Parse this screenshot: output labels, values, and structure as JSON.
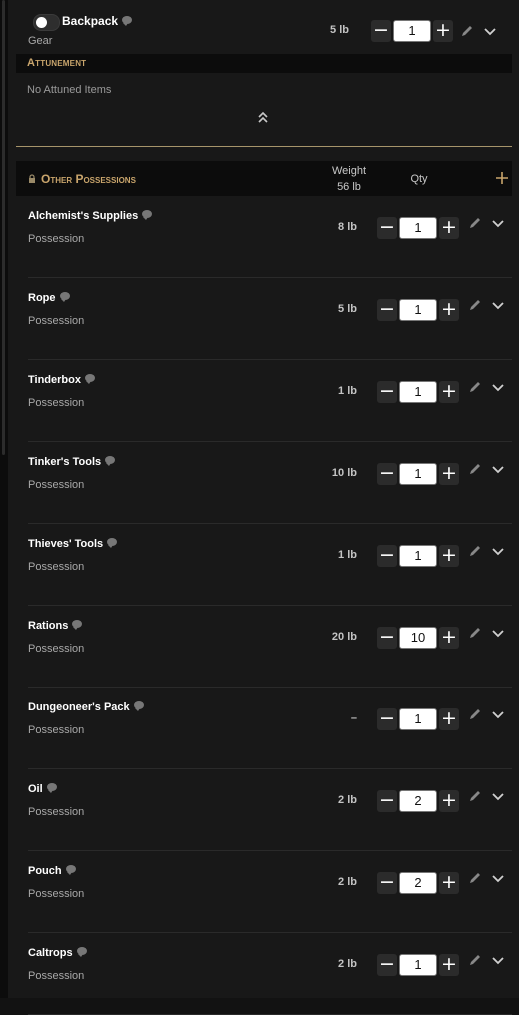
{
  "backpack": {
    "name": "Backpack",
    "type": "Gear",
    "weight": "5 lb",
    "qty": "1",
    "toggle_on": false
  },
  "attunement": {
    "title": "Attunement",
    "empty_text": "No Attuned Items"
  },
  "other_possessions": {
    "title": "Other Possessions",
    "weight_header": "Weight",
    "total_weight": "56 lb",
    "qty_header": "Qty",
    "items": [
      {
        "name": "Alchemist's Supplies",
        "type": "Possession",
        "weight": "8 lb",
        "qty": "1"
      },
      {
        "name": "Rope",
        "type": "Possession",
        "weight": "5 lb",
        "qty": "1"
      },
      {
        "name": "Tinderbox",
        "type": "Possession",
        "weight": "1 lb",
        "qty": "1"
      },
      {
        "name": "Tinker's Tools",
        "type": "Possession",
        "weight": "10 lb",
        "qty": "1"
      },
      {
        "name": "Thieves' Tools",
        "type": "Possession",
        "weight": "1 lb",
        "qty": "1"
      },
      {
        "name": "Rations",
        "type": "Possession",
        "weight": "20 lb",
        "qty": "10"
      },
      {
        "name": "Dungeoneer's Pack",
        "type": "Possession",
        "weight": "–",
        "qty": "1"
      },
      {
        "name": "Oil",
        "type": "Possession",
        "weight": "2 lb",
        "qty": "2"
      },
      {
        "name": "Pouch",
        "type": "Possession",
        "weight": "2 lb",
        "qty": "2"
      },
      {
        "name": "Caltrops",
        "type": "Possession",
        "weight": "2 lb",
        "qty": "1"
      }
    ]
  },
  "controls": {
    "minus": "−",
    "plus": "+"
  },
  "colors": {
    "accent_gold": "#c9a56c",
    "panel_bg": "#181818",
    "header_bg": "#0c0c0c"
  },
  "icons": [
    "comment-icon",
    "edit-icon",
    "chevron-down-icon",
    "collapse-up-icon",
    "lock-icon",
    "add-icon"
  ]
}
